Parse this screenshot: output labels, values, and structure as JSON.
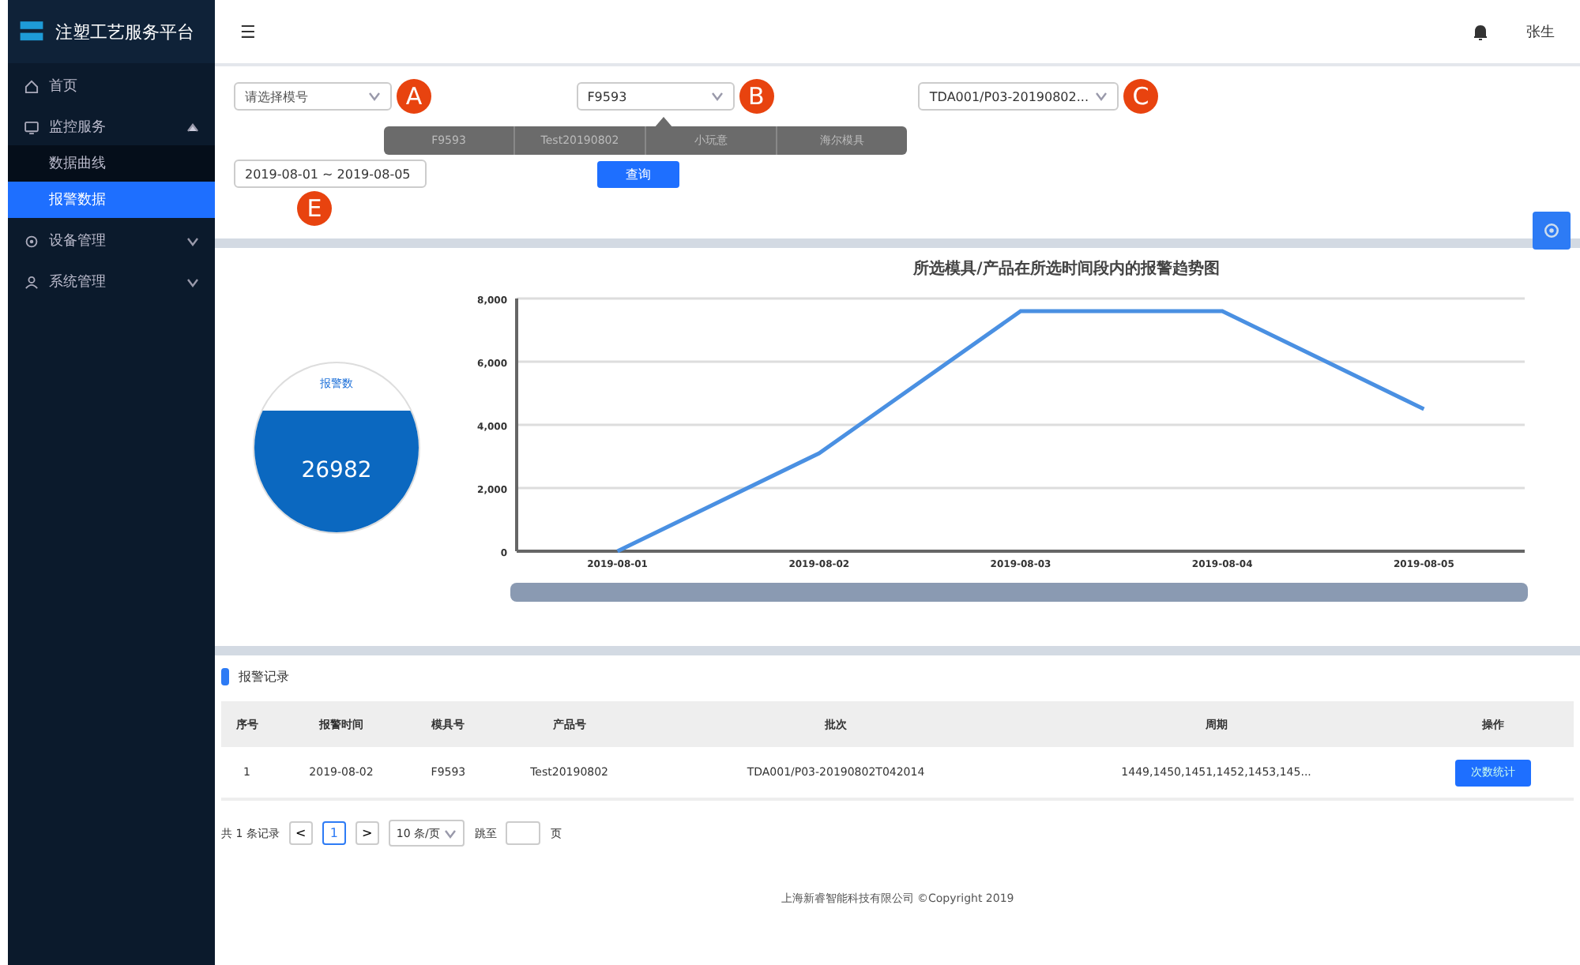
{
  "sidebar": {
    "logo": "注塑工艺服务平台",
    "items": [
      {
        "label": "首页"
      },
      {
        "label": "监控服务",
        "expanded": true,
        "children": [
          {
            "label": "数据曲线",
            "selected": false
          },
          {
            "label": "报警数据",
            "selected": true
          }
        ]
      },
      {
        "label": "设备管理",
        "expanded": false
      },
      {
        "label": "系统管理",
        "expanded": false
      }
    ]
  },
  "header": {
    "menu_glyph": "☰",
    "user": "张生"
  },
  "filters": [
    {
      "placeholder": "请选择模号",
      "marker": "A"
    },
    {
      "value": "F9593",
      "marker": "B",
      "open": true,
      "options": [
        "F9593",
        "Test20190802",
        "小玩意",
        "海尔模具"
      ]
    },
    {
      "value": "TDA001/P03-20190802...",
      "marker": "C"
    }
  ],
  "date_range": {
    "value": "2019-08-01 ~ 2019-08-05",
    "marker": "E"
  },
  "query_button": "查询",
  "gauge": {
    "label": "报警数",
    "value": "26982",
    "level": 0.72
  },
  "chart_data": {
    "type": "line",
    "title": "所选模具/产品在所选时间段内的报警趋势图",
    "categories": [
      "2019-08-01",
      "2019-08-02",
      "2019-08-03",
      "2019-08-04",
      "2019-08-05"
    ],
    "values": [
      0,
      3100,
      7600,
      7600,
      4500
    ],
    "grid": true,
    "ylim": [
      0,
      8000
    ],
    "yticks": [
      {
        "value": 0,
        "label": "0"
      },
      {
        "value": 2000,
        "label": "2,000"
      },
      {
        "value": 4000,
        "label": "4,000"
      },
      {
        "value": 6000,
        "label": "6,000"
      },
      {
        "value": 8000,
        "label": "8,000"
      }
    ]
  },
  "table": {
    "title": "报警记录",
    "columns": [
      "序号",
      "报警时间",
      "模具号",
      "产品号",
      "批次",
      "周期",
      "操作"
    ],
    "rows": [
      {
        "cells": [
          "1",
          "2019-08-02",
          "F9593",
          "Test20190802",
          "TDA001/P03-20190802T042014",
          "1449,1450,1451,1452,1453,145..."
        ],
        "action": "次数统计"
      }
    ]
  },
  "pagination": {
    "total": "共 1 条记录",
    "prev": "<",
    "pages": [
      {
        "label": "1",
        "selected": true
      }
    ],
    "next": ">",
    "page_size": "10 条/页",
    "jump_label": "跳至",
    "jump_suffix": "页"
  },
  "footer": "上海新睿智能科技有限公司 ©Copyright 2019"
}
